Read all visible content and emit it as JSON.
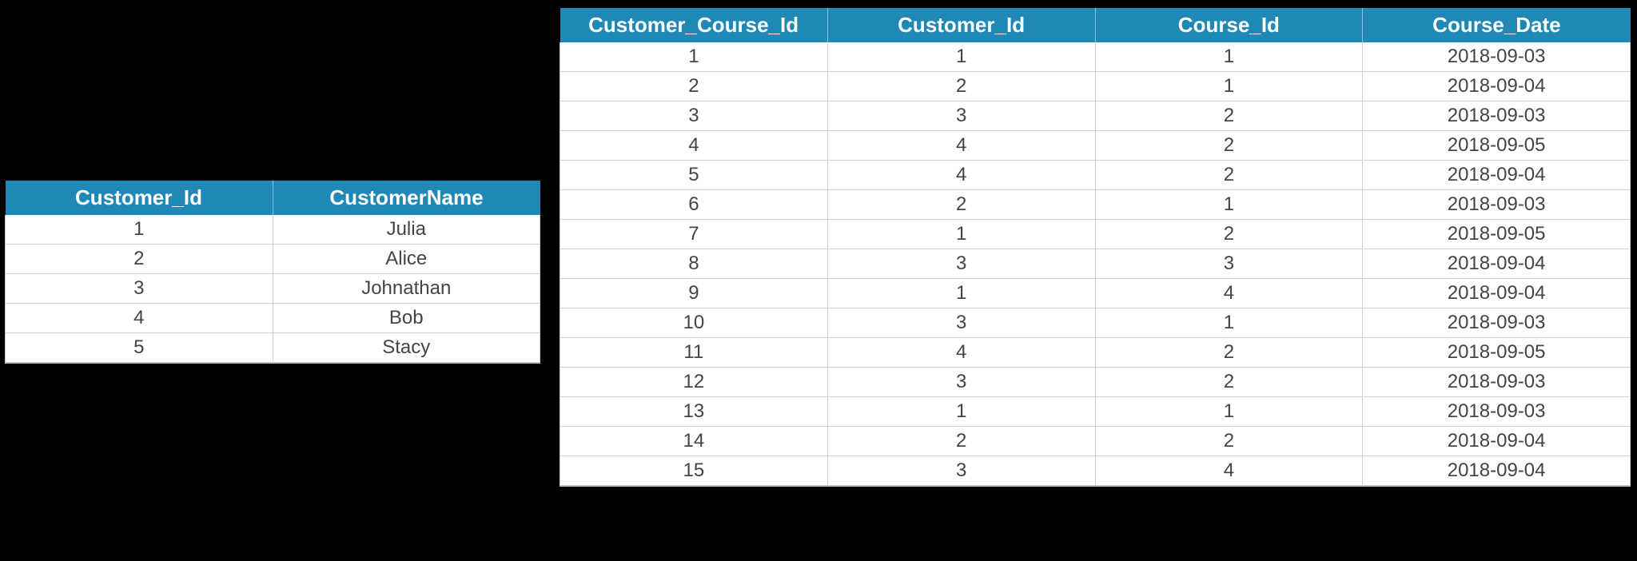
{
  "customers_table": {
    "headers": [
      "Customer_Id",
      "CustomerName"
    ],
    "rows": [
      {
        "Customer_Id": "1",
        "CustomerName": "Julia"
      },
      {
        "Customer_Id": "2",
        "CustomerName": "Alice"
      },
      {
        "Customer_Id": "3",
        "CustomerName": "Johnathan"
      },
      {
        "Customer_Id": "4",
        "CustomerName": "Bob"
      },
      {
        "Customer_Id": "5",
        "CustomerName": "Stacy"
      }
    ]
  },
  "customer_course_table": {
    "headers": [
      "Customer_Course_Id",
      "Customer_Id",
      "Course_Id",
      "Course_Date"
    ],
    "rows": [
      {
        "Customer_Course_Id": "1",
        "Customer_Id": "1",
        "Course_Id": "1",
        "Course_Date": "2018-09-03"
      },
      {
        "Customer_Course_Id": "2",
        "Customer_Id": "2",
        "Course_Id": "1",
        "Course_Date": "2018-09-04"
      },
      {
        "Customer_Course_Id": "3",
        "Customer_Id": "3",
        "Course_Id": "2",
        "Course_Date": "2018-09-03"
      },
      {
        "Customer_Course_Id": "4",
        "Customer_Id": "4",
        "Course_Id": "2",
        "Course_Date": "2018-09-05"
      },
      {
        "Customer_Course_Id": "5",
        "Customer_Id": "4",
        "Course_Id": "2",
        "Course_Date": "2018-09-04"
      },
      {
        "Customer_Course_Id": "6",
        "Customer_Id": "2",
        "Course_Id": "1",
        "Course_Date": "2018-09-03"
      },
      {
        "Customer_Course_Id": "7",
        "Customer_Id": "1",
        "Course_Id": "2",
        "Course_Date": "2018-09-05"
      },
      {
        "Customer_Course_Id": "8",
        "Customer_Id": "3",
        "Course_Id": "3",
        "Course_Date": "2018-09-04"
      },
      {
        "Customer_Course_Id": "9",
        "Customer_Id": "1",
        "Course_Id": "4",
        "Course_Date": "2018-09-04"
      },
      {
        "Customer_Course_Id": "10",
        "Customer_Id": "3",
        "Course_Id": "1",
        "Course_Date": "2018-09-03"
      },
      {
        "Customer_Course_Id": "11",
        "Customer_Id": "4",
        "Course_Id": "2",
        "Course_Date": "2018-09-05"
      },
      {
        "Customer_Course_Id": "12",
        "Customer_Id": "3",
        "Course_Id": "2",
        "Course_Date": "2018-09-03"
      },
      {
        "Customer_Course_Id": "13",
        "Customer_Id": "1",
        "Course_Id": "1",
        "Course_Date": "2018-09-03"
      },
      {
        "Customer_Course_Id": "14",
        "Customer_Id": "2",
        "Course_Id": "2",
        "Course_Date": "2018-09-04"
      },
      {
        "Customer_Course_Id": "15",
        "Customer_Id": "3",
        "Course_Id": "4",
        "Course_Date": "2018-09-04"
      }
    ]
  }
}
